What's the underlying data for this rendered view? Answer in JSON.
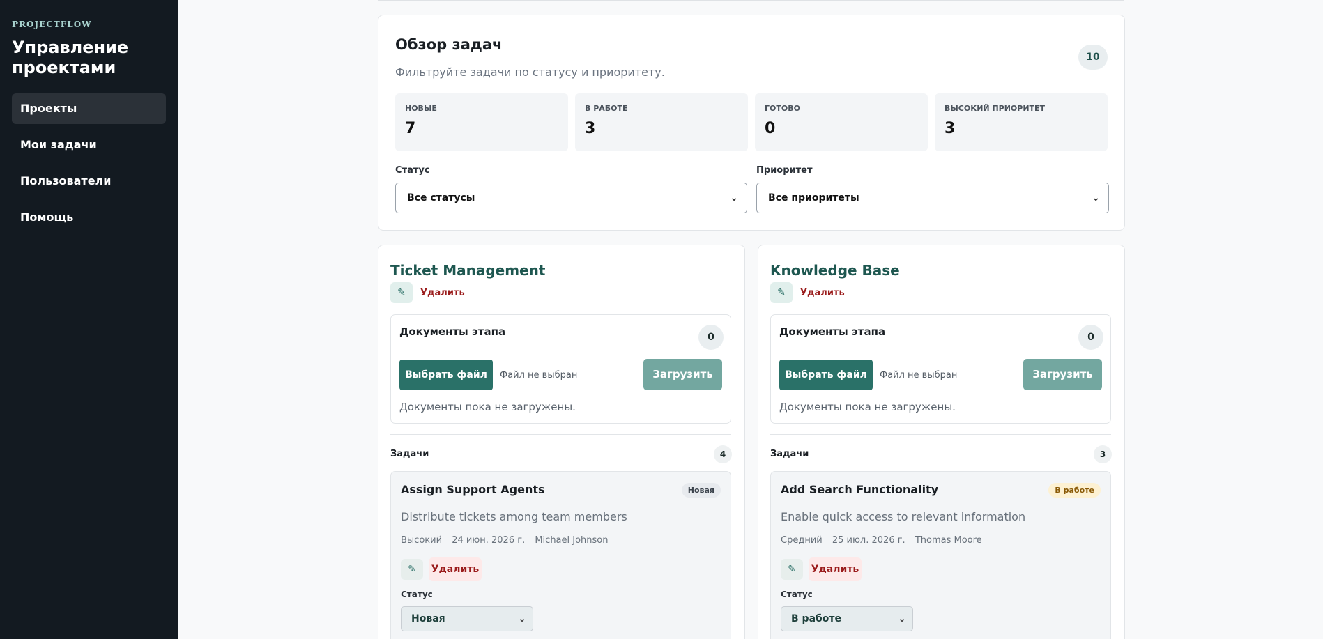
{
  "sidebar": {
    "brand": "PROJECTFLOW",
    "title": "Управление проектами",
    "nav": [
      {
        "label": "Проекты",
        "active": true
      },
      {
        "label": "Мои задачи",
        "active": false
      },
      {
        "label": "Пользователи",
        "active": false
      },
      {
        "label": "Помощь",
        "active": false
      }
    ]
  },
  "overview": {
    "title": "Обзор задач",
    "subtitle": "Фильтруйте задачи по статусу и приоритету.",
    "total": "10",
    "stats": [
      {
        "label": "НОВЫЕ",
        "value": "7"
      },
      {
        "label": "В РАБОТЕ",
        "value": "3"
      },
      {
        "label": "ГОТОВО",
        "value": "0"
      },
      {
        "label": "ВЫСОКИЙ ПРИОРИТЕТ",
        "value": "3"
      }
    ],
    "status_filter": {
      "label": "Статус",
      "value": "Все статусы"
    },
    "priority_filter": {
      "label": "Приоритет",
      "value": "Все приоритеты"
    }
  },
  "projects": [
    {
      "name": "Ticket Management",
      "delete_label": "Удалить",
      "docs": {
        "title": "Документы этапа",
        "count": "0",
        "choose_label": "Выбрать файл",
        "no_file": "Файл не выбран",
        "upload_label": "Загрузить",
        "empty": "Документы пока не загружены."
      },
      "tasks_label": "Задачи",
      "tasks_count": "4",
      "task": {
        "title": "Assign Support Agents",
        "badge": "Новая",
        "description": "Distribute tickets among team members",
        "priority": "Высокий",
        "due": "24 июн. 2026 г.",
        "assignee": "Michael Johnson",
        "delete_label": "Удалить",
        "status_label": "Статус",
        "status_value": "Новая"
      }
    },
    {
      "name": "Knowledge Base",
      "delete_label": "Удалить",
      "docs": {
        "title": "Документы этапа",
        "count": "0",
        "choose_label": "Выбрать файл",
        "no_file": "Файл не выбран",
        "upload_label": "Загрузить",
        "empty": "Документы пока не загружены."
      },
      "tasks_label": "Задачи",
      "tasks_count": "3",
      "task": {
        "title": "Add Search Functionality",
        "badge": "В работе",
        "description": "Enable quick access to relevant information",
        "priority": "Средний",
        "due": "25 июл. 2026 г.",
        "assignee": "Thomas Moore",
        "delete_label": "Удалить",
        "status_label": "Статус",
        "status_value": "В работе"
      }
    }
  ],
  "icons": {
    "edit": "pencil-icon",
    "dropdown": "chevron-down-icon"
  }
}
